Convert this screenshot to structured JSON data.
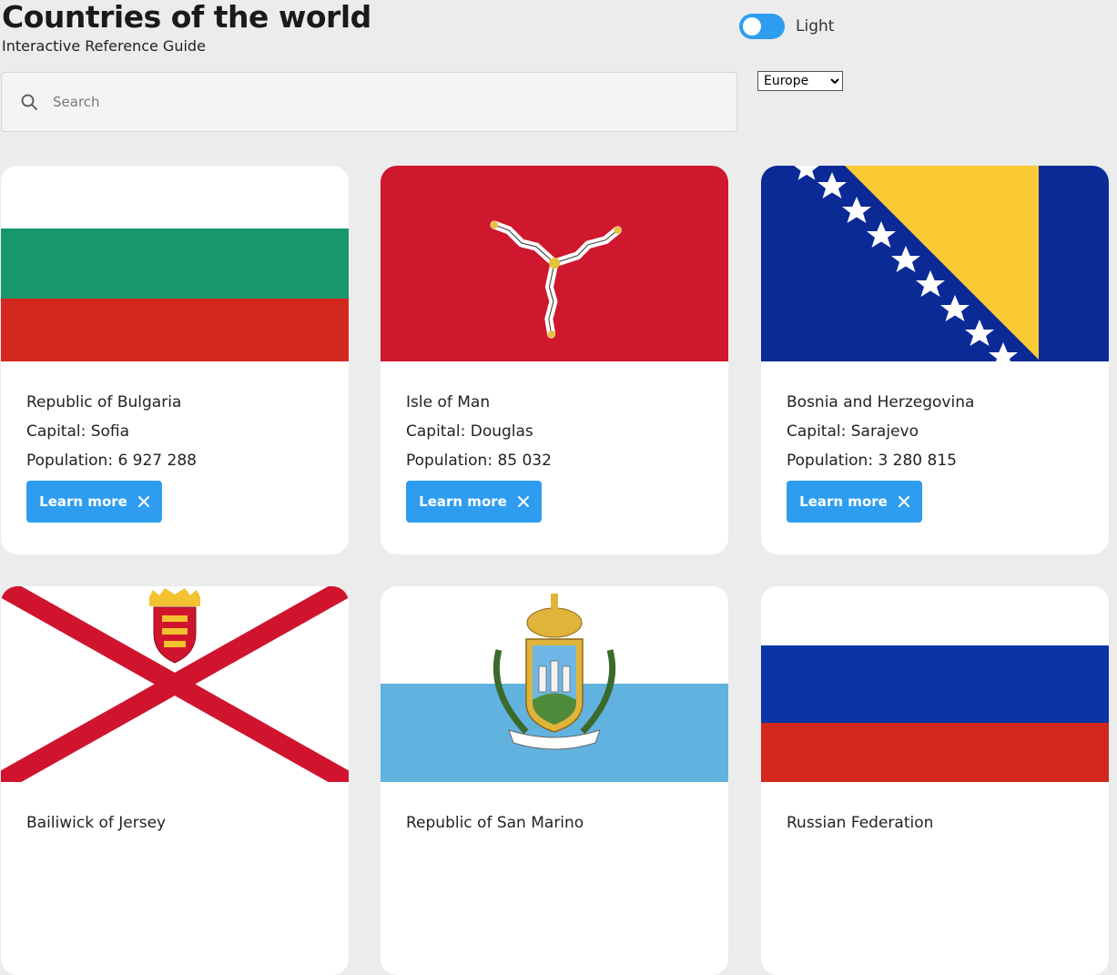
{
  "header": {
    "title": "Countries of the world",
    "subtitle": "Interactive Reference Guide"
  },
  "theme_toggle": {
    "label": "Light",
    "on": true
  },
  "search": {
    "placeholder": "Search",
    "value": ""
  },
  "region_select": {
    "selected": "Europe"
  },
  "icons": {
    "search": "search-icon",
    "close": "close-icon"
  },
  "colors": {
    "accent": "#2e9df0",
    "background": "#ececec",
    "card": "#ffffff"
  },
  "countries": [
    {
      "name": "Republic of Bulgaria",
      "capital": "Capital: Sofia",
      "population": "Population: 6 927 288",
      "button": "Learn more",
      "flag": "bulgaria-flag"
    },
    {
      "name": "Isle of Man",
      "capital": "Capital: Douglas",
      "population": "Population: 85 032",
      "button": "Learn more",
      "flag": "isle-of-man-flag"
    },
    {
      "name": "Bosnia and Herzegovina",
      "capital": "Capital: Sarajevo",
      "population": "Population: 3 280 815",
      "button": "Learn more",
      "flag": "bosnia-flag"
    },
    {
      "name": "Bailiwick of Jersey",
      "flag": "jersey-flag"
    },
    {
      "name": "Republic of San Marino",
      "flag": "san-marino-flag"
    },
    {
      "name": "Russian Federation",
      "flag": "russia-flag"
    }
  ]
}
